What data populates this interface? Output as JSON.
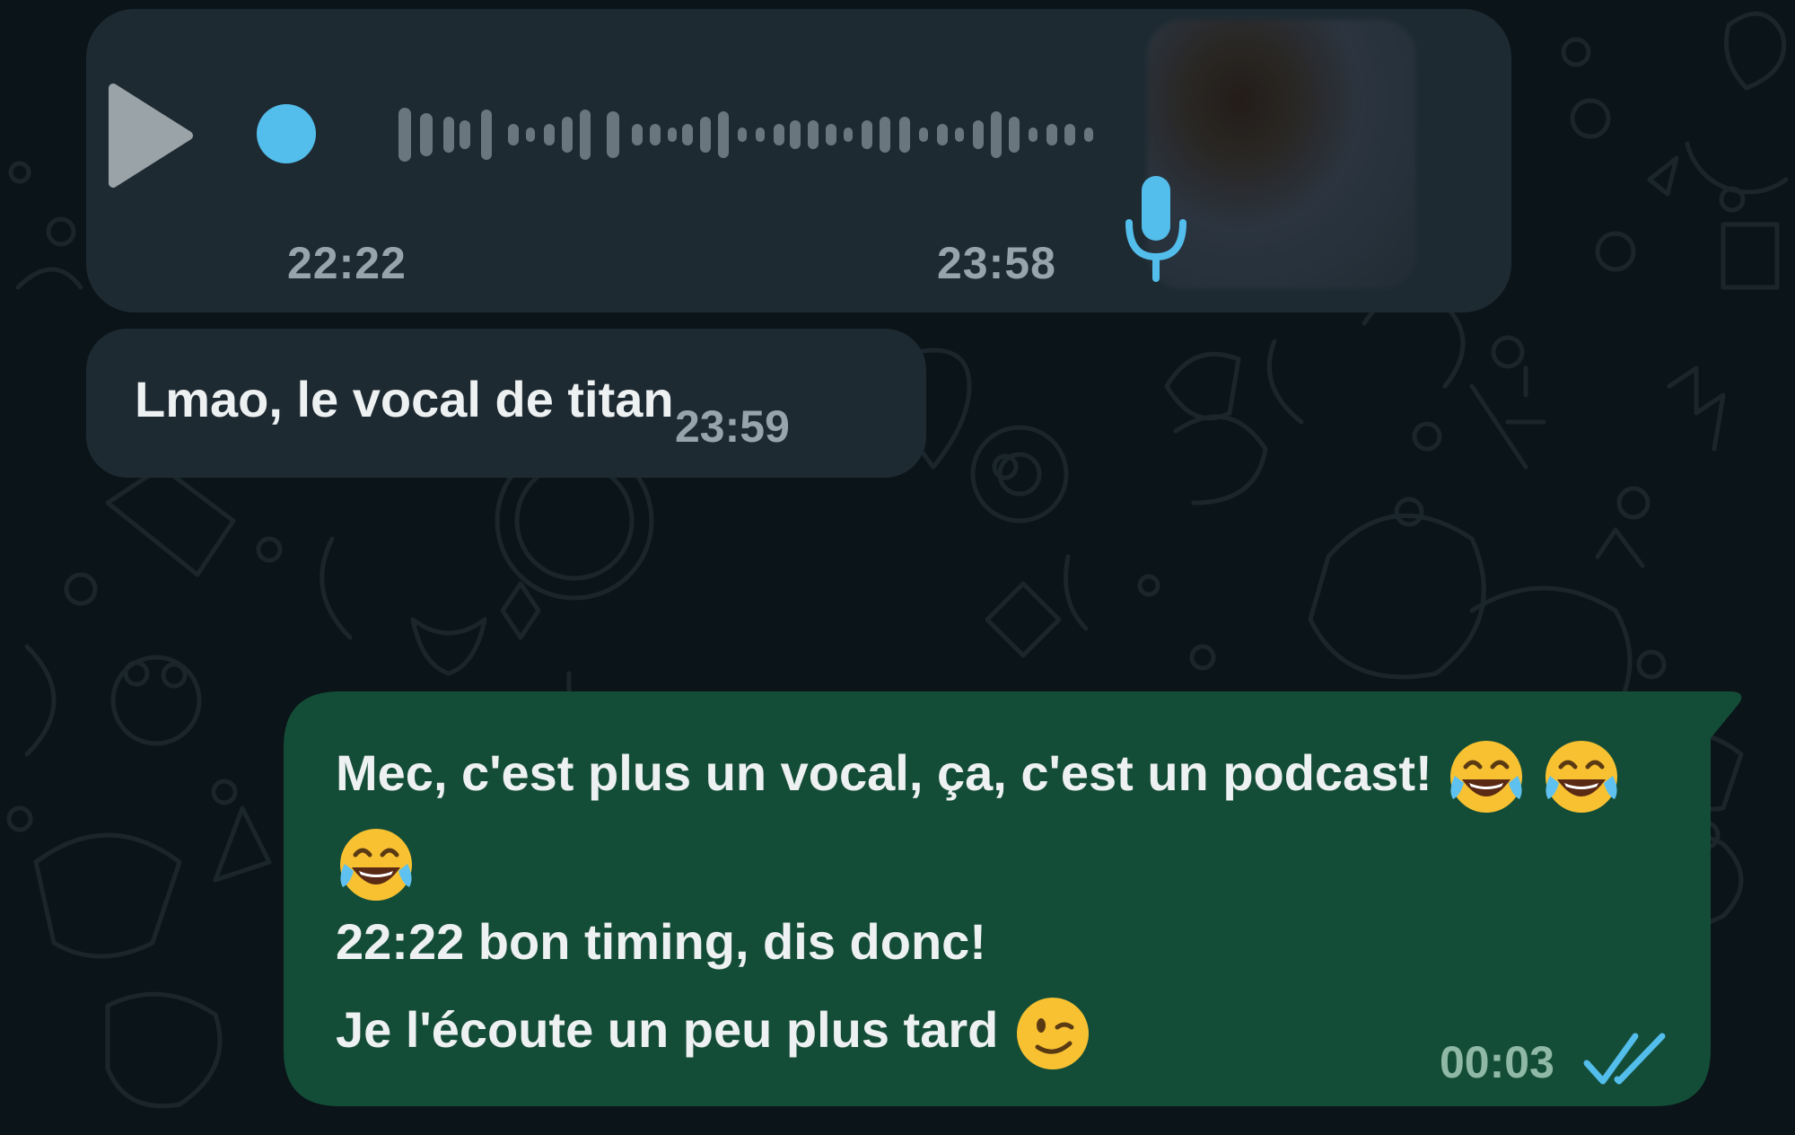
{
  "colors": {
    "background": "#0b1418",
    "incoming_bubble": "#1e2a32",
    "outgoing_bubble": "#144d37",
    "accent": "#53bdeb",
    "text": "#eef1f2",
    "timestamp": "#98a4ac"
  },
  "voice_message": {
    "play_icon": "play-icon",
    "mic_icon": "microphone-icon",
    "progress": 0.0,
    "elapsed": "22:22",
    "time": "23:58"
  },
  "text_message_in": {
    "text": "Lmao, le vocal de titan",
    "time": "23:59"
  },
  "text_message_out": {
    "line1": "Mec, c'est plus un vocal, ça, c'est un podcast!",
    "line3": "22:22 bon timing, dis donc!",
    "line4": "Je l'écoute un peu plus tard",
    "emojis": [
      "face-with-tears-of-joy",
      "winking-face"
    ],
    "time": "00:03",
    "status_icon": "double-check-read-icon"
  }
}
